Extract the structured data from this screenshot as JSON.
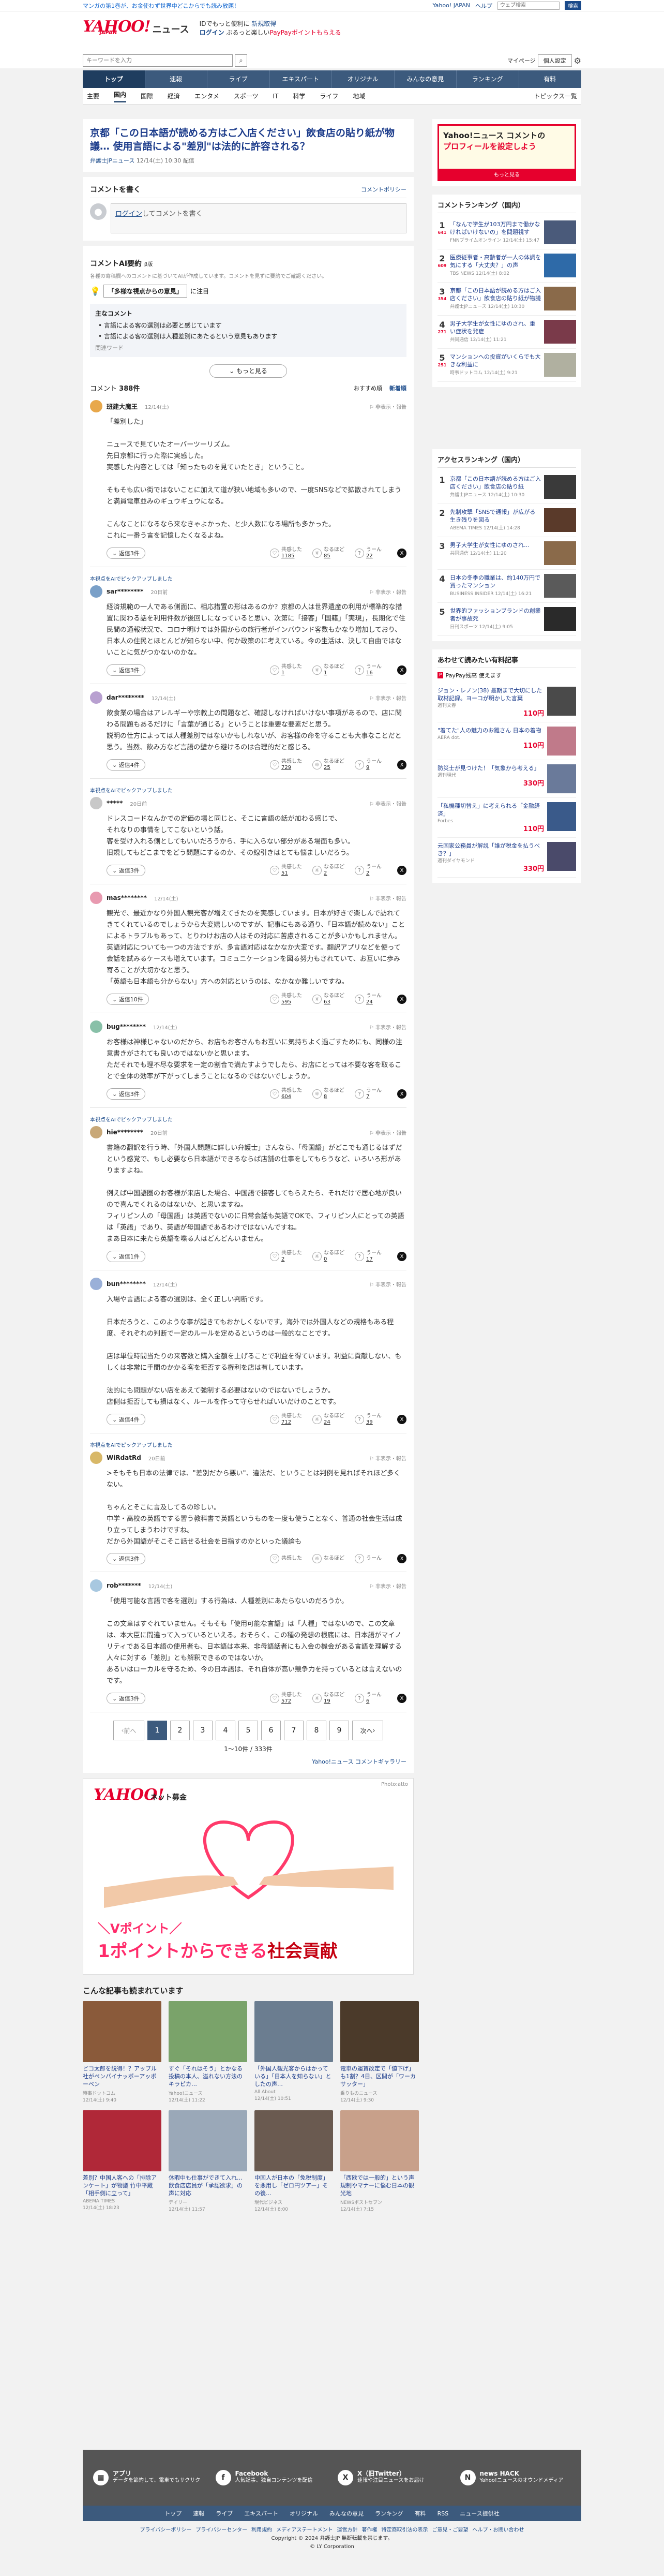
{
  "topbar": {
    "promo": "マンガの第1巻が、お金使わず世界中どこからでも読み放題！",
    "links": [
      "Yahoo! JAPAN",
      "ヘルプ"
    ],
    "search_placeholder": "ウェブ検索",
    "search_button": "検索"
  },
  "header": {
    "logo": "YAHOO!",
    "logo_japan": "JAPAN",
    "logo_news": "ニュース",
    "line1": "IDでもっと便利に",
    "line1_link": "新規取得",
    "line2_login": "ログイン",
    "line2_rest": "ぶるっと楽しい",
    "line2_pp": "PayPayポイントもらえる"
  },
  "search": {
    "placeholder": "キーワードを入力",
    "mypage": "マイページ",
    "account": "個人設定"
  },
  "nav_main": [
    "トップ",
    "速報",
    "ライブ",
    "エキスパート",
    "オリジナル",
    "みんなの意見",
    "ランキング",
    "有料"
  ],
  "nav_sub": [
    "主要",
    "国内",
    "国際",
    "経済",
    "エンタメ",
    "スポーツ",
    "IT",
    "科学",
    "ライフ",
    "地域"
  ],
  "nav_sub_right": "トピックス一覧",
  "article": {
    "title": "京都「この日本語が読める方はご入店ください」飲食店の貼り紙が物議… 使用言語による\"差別\"は法的に許容される？",
    "source": "弁護士JPニュース",
    "date": "12/14(土) 10:30",
    "extra": "配信"
  },
  "write": {
    "heading": "コメントを書く",
    "policy": "コメントポリシー",
    "prompt_link": "ログイン",
    "prompt_rest": "してコメントを書く"
  },
  "ai": {
    "heading": "コメントAI要約",
    "beta": "β版",
    "note": "各種の寄稿欄へのコメントに基づいてAIが作成しています。コメントを見ずに要約でご確認ください。",
    "badge": "「多様な視点からの意見」",
    "badge_rest": "に注目",
    "topics_heading": "主なコメント",
    "topics": [
      "言語による客の選別は必要と感じています",
      "言語による客の選別は人種差別にあたるという意見もあります"
    ],
    "keywords": "関連ワード",
    "more": "もっと見る"
  },
  "comments_header": {
    "label": "コメント",
    "count": "388件",
    "sorts": [
      "おすすめ順",
      "新着順"
    ]
  },
  "comments": [
    {
      "ai": "",
      "name": "班建大魔王",
      "time": "12/14(土)",
      "body": "「差別した」\n\nニュースで見ていたオーバーツーリズム。\n先日京都に行った際に実感した。\n実感した内容としては「知ったものを見ていたとき」ということ。\n\nそもそも広い街ではないことに加えて道が狭い地域も多いので、一度SNSなどで拡散されてしまうと満員電車並みのギュウギュウになる。\n\nこんなことになるなら来なきゃよかった、と少人数になる場所も多かった。\nこれに一番う言を記憶したくなるよね。",
      "reply": "返信3件",
      "r1": "1185",
      "r2": "85",
      "r3": "22"
    },
    {
      "ai": "本視点をAIでピックアップしました",
      "name": "sar********",
      "time": "20日前",
      "body": "経済規範の一人である側面に、相応措置の形はあるのか？京都の人は世界遺産の利用が標準的な措置に関わる話を利用件数が後回しになっていると思い、次第に「接客」「国籍」「実現」，長期化で住民間の通報状況で、コロナ明けでは外国からの旅行者がインバウンド客数もかなり増加しており、日本人の住民とほとんどが知らない中、何か政策のに考えている。今の生活は、決して自由ではないことに気がつかないのかな。",
      "reply": "返信3件",
      "r1": "1",
      "r2": "1",
      "r3": "16"
    },
    {
      "ai": "",
      "name": "dar********",
      "time": "12/14(土)",
      "body": "飲食業の場合はアレルギーや宗教上の問題など、確認しなければいけない事項があるので、店に関わる問題もあるだけに「言葉が通じる」ということは重要な要素だと思う。\n説明の仕方によっては人種差別ではないかもしれないが、お客様の命を守ることも大事なことだと思う。当然、飲み方など言語の壁から避けるのは合理的だと感じる。",
      "reply": "返信4件",
      "r1": "729",
      "r2": "25",
      "r3": "9"
    },
    {
      "ai": "本視点をAIでピックアップしました",
      "name": "*****",
      "time": "20日前",
      "body": "ドレスコードなんかでの定価の場と同じと、そこに言語の話が加わる感じで、\nそれなりの事情をしてこないという話。\n客を受け入れる側としてもいいだろうから、手に入らない部分がある場面も多い。\n旧規してもどこまでをどう問題にするのか、その線引きはとても悩ましいだろう。",
      "reply": "返信3件",
      "r1": "51",
      "r2": "2",
      "r3": "2"
    },
    {
      "ai": "",
      "name": "mas********",
      "time": "12/14(土)",
      "body": "観光で、最近かなり外国人観光客が増えてきたのを実感しています。日本が好きで楽しんで訪れてきてくれているのでしょうから大変嬉しいのですが、記事にもある通り、「日本語が読めない」ことによるトラブルもあって、とりわけお店の人はその対応に苦慮されることが多いかもしれません。\n英語対応についても一つの方法ですが、多言語対応はなかなか大変です。翻訳アプリなどを使って会話を試みるケースも増えています。コミュニケーションを図る努力もされていて、お互いに歩み寄ることが大切かなと思う。\n「英語も日本語も分からない」方への対応というのは、なかなか難しいですね。",
      "reply": "返信10件",
      "r1": "595",
      "r2": "63",
      "r3": "24"
    },
    {
      "ai": "",
      "name": "bug********",
      "time": "12/14(土)",
      "body": "お客様は神様じゃないのだから、お店もお客さんもお互いに気持ちよく過ごすためにも、同様の注意書きがされても良いのではないかと思います。\nただそれでも理不尽な要求を一定の割合で満たすようでしたら、お店にとっては不要な客を取ることで全体の効率が下がってしまうことになるのではないでしょうか。",
      "reply": "返信3件",
      "r1": "604",
      "r2": "8",
      "r3": "7"
    },
    {
      "ai": "本視点をAIでピックアップしました",
      "name": "hie********",
      "time": "20日前",
      "body": "書籍の翻訳を行う時、「外国人問題に詳しい弁護士」さんなら、「母国語」がどこでも通じるはずだという感覚で、もし必要なら日本語ができるならば店舗の仕事をしてもらうなど、いろいろ形がありますよね。\n\n例えば中国語圏のお客様が来店した場合、中国語で接客してもらえたら、それだけで居心地が良いので喜んでくれるのはないか、と思いますね。\nフィリピン人の「母国語」は英語でないのに日常会話も英語でOKで、フィリピン人にとっての英語は「英語」であり、英語が母国語であるわけではないんですね。\nまあ日本に来たら英語を喋る人はどんどんいません。",
      "reply": "返信1件",
      "r1": "2",
      "r2": "0",
      "r3": "17"
    },
    {
      "ai": "",
      "name": "bun********",
      "time": "12/14(土)",
      "body": "入場や言語による客の選別は、全く正しい判断です。\n\n日本だろうと、このような事が起きてもおかしくないです。海外では外国人などの規格もある程度、それぞれの判断で一定のルールを定めるというのは一般的なことです。\n\n店は単位時間当たりの来客数と購入金額を上げることで利益を得ています。利益に貢献しない、もしくは非常に手間のかかる客を拒否する権利を店は有しています。\n\n法的にも問題がない店をあえて強制する必要はないのではないでしょうか。\n店側は拒否しても損はなく、ルールを作って守らせればいいだけのことです。",
      "reply": "返信4件",
      "r1": "712",
      "r2": "24",
      "r3": "39"
    },
    {
      "ai": "本視点をAIでピックアップしました",
      "name": "WiRdatRd",
      "time": "20日前",
      "body": ">そもそも日本の法律では、\"差別だから悪い\"、違法だ、ということは判例を見ればそれほど多くない。\n\nちゃんとそこに言及してるの珍しい。\n中学・高校の英語でする習う教科書で英語というものを一度も使うことなく、普通の社会生活は成り立ってしまうわけですね。\nだから外国語がそこそこ話せる社会を目指すのかといった議論も",
      "reply": "返信3件",
      "r1": "",
      "r2": "",
      "r3": ""
    },
    {
      "ai": "",
      "name": "rob*******",
      "time": "12/14(土)",
      "body": "「使用可能な言語で客を選別」する行為は、人種差別にあたらないのだろうか。\n\nこの文章はすぐれていません。そもそも「使用可能な言語」は「人種」ではないので、この文章は、本大臣に間違って入っているといえる。おそらく、この種の発想の根底には、日本語がマイノリティである日本語の使用者も、日本語は本来、非母語話者にも入会の機会がある言語を理解する人々に対する「差別」とも解釈できるのではないか。\nあるいはローカルを守るため、今の日本語は、それ自体が高い競争力を持っているとは言えないのです。",
      "reply": "返信3件",
      "r1": "572",
      "r2": "19",
      "r3": "6"
    }
  ],
  "reactions": [
    "共感した",
    "なるほど",
    "うーん"
  ],
  "pager": {
    "prev": "前へ",
    "pages": [
      "1",
      "2",
      "3",
      "4",
      "5",
      "6",
      "7",
      "8",
      "9"
    ],
    "next": "次へ",
    "info": "1〜10件 / 333件"
  },
  "gallery_link": "Yahoo!ニュース コメントギャラリー",
  "ad": {
    "logo": "YAHOO!",
    "label": "ネット募金",
    "credit": "Photo:atto",
    "cap1": "＼Vポイント／",
    "cap2_a": "1ポイントからできる",
    "cap2_b": "社会貢献"
  },
  "related": {
    "heading": "こんな記事も読まれています",
    "items": [
      {
        "title": "ピコ太郎を説得！？アップル社がペンパイナッポーアッポーペン",
        "src": "時事ドットコム",
        "date": "12/14(土) 9:40",
        "color": "#8a5a3a"
      },
      {
        "title": "すぐ「それはそう」とかなる投稿の本人、溢れない方法のキラピカ…",
        "src": "Yahoo!ニュース",
        "date": "12/14(土) 11:22",
        "color": "#7aa36a"
      },
      {
        "title": "「外国人観光客からはかっている」「日本人を知らない」としたの声…",
        "src": "All About",
        "date": "12/14(土) 10:51",
        "color": "#6b7d90"
      },
      {
        "title": "電車の運賃改定で「値下げ」も1割？4日、区間が「ワーカサッター」",
        "src": "乗りものニュース",
        "date": "12/14(土) 9:30",
        "color": "#4b3a2a"
      },
      {
        "title": "差別？中国人客への「排除アンケート」が物議 竹中平蔵「相手側に立って」",
        "src": "ABEMA TIMES",
        "date": "12/14(土) 18:23",
        "color": "#b02838"
      },
      {
        "title": "休暇中も仕事ができて入れ...飲食店店員が「承認欲求」の声に対応",
        "src": "デイリー",
        "date": "12/14(土) 11:57",
        "color": "#9aa8b8"
      },
      {
        "title": "中国人が日本の「免税制度」を悪用し「ゼロ円ツアー」その後…",
        "src": "現代ビジネス",
        "date": "12/14(土) 8:00",
        "color": "#6a5a50"
      },
      {
        "title": "「西欧では一般的」という声 規制やマナーに悩む日本の観光地",
        "src": "NEWSポストセブン",
        "date": "12/14(土) 7:15",
        "color": "#c8a08a"
      }
    ]
  },
  "side": {
    "banner_a": "Yahoo!ニュース コメントの",
    "banner_b": "プロフィールを設定しよう",
    "banner_c": "もっと見る",
    "rank_heading": "コメントランキング（国内）",
    "rank": [
      {
        "no": "1",
        "cnt": "641",
        "title": "「なんで学生が103万円まで働かなければいけないの」を問題視す",
        "meta": "FNNプライムオンライン 12/14(土) 15:47",
        "color": "#4a5a7a"
      },
      {
        "no": "2",
        "cnt": "609",
        "title": "医療従事者・高齢者が一人の体調を気にする「大丈夫？」の声",
        "meta": "TBS NEWS 12/14(土) 8:02",
        "color": "#2e6aa8"
      },
      {
        "no": "3",
        "cnt": "354",
        "title": "京都「この日本語が読める方はご入店ください」飲食店の貼り紙が物議",
        "meta": "弁護士JPニュース 12/14(土) 10:30",
        "color": "#8a6a4a"
      },
      {
        "no": "4",
        "cnt": "271",
        "title": "男子大学生が女性にゆのされ、重い症状を発症",
        "meta": "共同通信 12/14(土) 11:21",
        "color": "#7a3a4a"
      },
      {
        "no": "5",
        "cnt": "251",
        "title": "マンションへの投資がいくらでも大きな利益に",
        "meta": "時事ドットコム 12/14(土) 9:21",
        "color": "#b0b0a0"
      }
    ],
    "access_heading": "アクセスランキング（国内）",
    "access": [
      {
        "no": "1",
        "title": "京都「この日本語が読める方はご入店ください」飲食店の貼り紙",
        "meta": "弁護士JPニュース 12/14(土) 10:30",
        "color": "#3a3a3a"
      },
      {
        "no": "2",
        "title": "先制攻撃「SNSで通報」が広がる 生き残りを図る ",
        "meta": "ABEMA TIMES 12/14(土) 14:28",
        "color": "#5a3a2a"
      },
      {
        "no": "3",
        "title": "男子大学生が女性にゆのされ…",
        "meta": "共同通信 12/14(土) 11:20",
        "color": "#8a6a4a"
      },
      {
        "no": "4",
        "title": "日本の冬季の職業は、約140万円で買ったマンション",
        "meta": "BUSINESS INSIDER 12/14(土) 16:21",
        "color": "#5a5a5a"
      },
      {
        "no": "5",
        "title": "世界的ファッションブランドの創業者が事故死",
        "meta": "日刊スポーツ 12/14(土) 9:05",
        "color": "#2a2a2a"
      }
    ],
    "paid_heading": "あわせて読みたい有料記事",
    "paid_sub": "PayPay残高 使えます",
    "paid": [
      {
        "title": "ジョン・レノン(38) 最期まで大切にした取材記録。ヨーコが明かした言葉",
        "shop": "週刊文春",
        "price": "110円",
        "color": "#4a4a4a"
      },
      {
        "title": "\"着てた\"人の魅力のお雛さん 日本の着物",
        "shop": "AERA dot.",
        "price": "110円",
        "color": "#c07a8a"
      },
      {
        "title": "防災士が見つけた！「気象から考える」",
        "shop": "週刊現代",
        "price": "330円",
        "color": "#6a7a9a"
      },
      {
        "title": "「私機種切替え」に考えられる「金融経済」",
        "shop": "Forbes",
        "price": "110円",
        "color": "#3a5a8a"
      },
      {
        "title": "元国家公務員が解説「誰が税金を払うべき？」",
        "shop": "週刊ダイヤモンド",
        "price": "330円",
        "color": "#4a4a6a"
      }
    ]
  },
  "footer": {
    "cols": [
      {
        "icon": "▦",
        "title": "アプリ",
        "text": "データを節約して、電車でもサクサク"
      },
      {
        "icon": "f",
        "title": "Facebook",
        "text": "人気記事、独自コンテンツを配信"
      },
      {
        "icon": "X",
        "title": "X（旧Twitter）",
        "text": "速報や注目ニュースをお届け"
      },
      {
        "icon": "N",
        "title": "news HACK",
        "text": "Yahoo!ニュースのオウンドメディア"
      }
    ],
    "nav": [
      "トップ",
      "速報",
      "ライブ",
      "エキスパート",
      "オリジナル",
      "みんなの意見",
      "ランキング",
      "有料",
      "RSS",
      "ニュース提供社"
    ],
    "links": [
      "プライバシーポリシー",
      "プライバシーセンター",
      "利用規約",
      "メディアステートメント",
      "運営方針",
      "著作権",
      "特定商取引法の表示",
      "ご意見・ご要望",
      "ヘルプ・お問い合わせ"
    ],
    "copy": "Copyright © 2024 弁護士JP 無断転載を禁じます。",
    "copy2": "© LY Corporation"
  }
}
